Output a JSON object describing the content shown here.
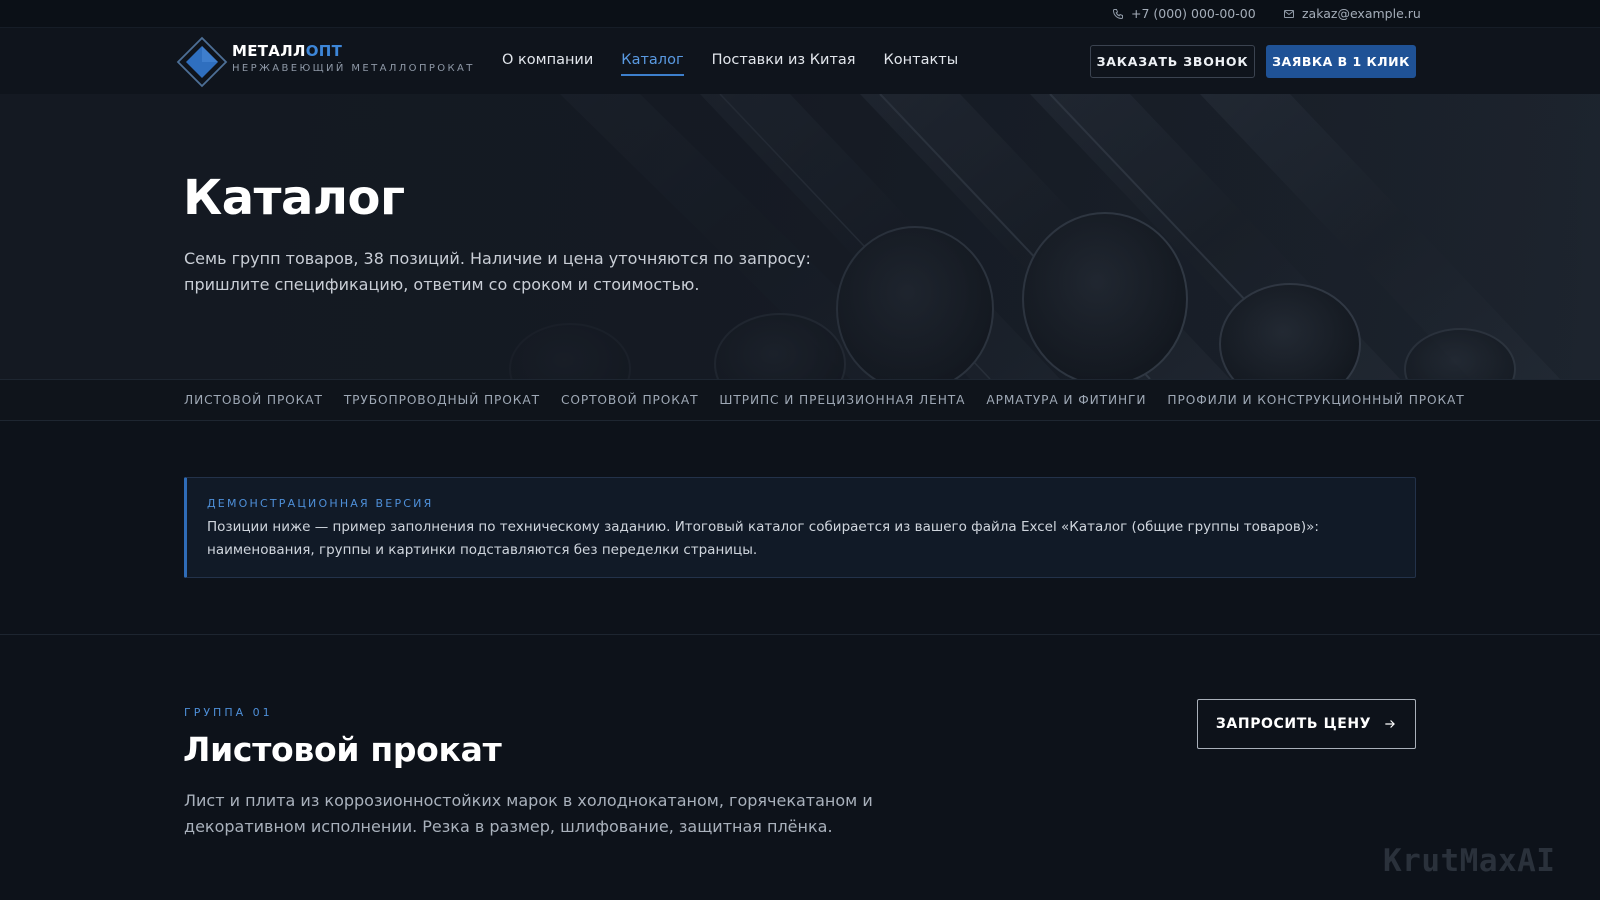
{
  "topbar": {
    "phone": "+7 (000) 000-00-00",
    "email": "zakaz@example.ru"
  },
  "header": {
    "logo_name_main": "МЕТАЛЛ",
    "logo_name_accent": "ОПТ",
    "logo_tagline": "НЕРЖАВЕЮЩИЙ МЕТАЛЛОПРОКАТ",
    "nav": [
      {
        "label": "О компании"
      },
      {
        "label": "Каталог",
        "active": true
      },
      {
        "label": "Поставки из Китая"
      },
      {
        "label": "Контакты"
      }
    ],
    "call_button": "ЗАКАЗАТЬ ЗВОНОК",
    "apply_button": "ЗАЯВКА В 1 КЛИК"
  },
  "hero": {
    "title": "Каталог",
    "subtitle": "Семь групп товаров, 38 позиций. Наличие и цена уточняются по запросу: пришлите спецификацию, ответим со сроком и стоимостью."
  },
  "categories": [
    {
      "label": "ЛИСТОВОЙ ПРОКАТ"
    },
    {
      "label": "ТРУБОПРОВОДНЫЙ ПРОКАТ"
    },
    {
      "label": "СОРТОВОЙ ПРОКАТ"
    },
    {
      "label": "ШТРИПС И ПРЕЦИЗИОННАЯ ЛЕНТА"
    },
    {
      "label": "АРМАТУРА И ФИТИНГИ"
    },
    {
      "label": "ПРОФИЛИ И КОНСТРУКЦИОННЫЙ ПРОКАТ"
    }
  ],
  "notice": {
    "kicker": "ДЕМОНСТРАЦИОННАЯ ВЕРСИЯ",
    "text": "Позиции ниже — пример заполнения по техническому заданию. Итоговый каталог собирается из вашего файла Excel «Каталог (общие группы товаров)»: наименования, группы и картинки подставляются без переделки страницы."
  },
  "group": {
    "kicker": "ГРУППА 01",
    "title": "Листовой прокат",
    "description": "Лист и плита из коррозионностойких марок в холоднокатаном, горячекатаном и декоративном исполнении. Резка в размер, шлифование, защитная плёнка.",
    "price_button": "ЗАПРОСИТЬ ЦЕНУ"
  },
  "watermark": "KrutMaxAI",
  "colors": {
    "background": "#0d121a",
    "accent": "#3d86d8",
    "primary_button": "#1f5296"
  },
  "icons": {
    "phone": "phone-icon",
    "email": "mail-icon",
    "logo": "diamond-logo-icon",
    "arrow": "arrow-right-icon"
  }
}
